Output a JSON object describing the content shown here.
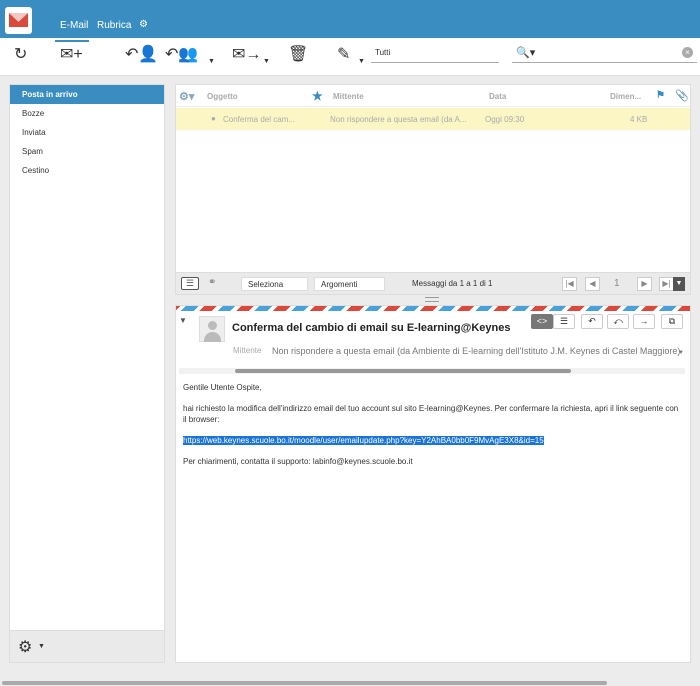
{
  "nav": {
    "mail": "E-Mail",
    "contacts": "Rubrica",
    "settings_icon": "⚙"
  },
  "toolbar": {
    "refresh_icon": "↻",
    "compose_icon": "✉+",
    "reply_icon": "↶👤",
    "replyall_icon": "↶👥",
    "forward_icon": "✉→",
    "delete_icon": "🗑",
    "mark_icon": "✎",
    "filter": "Tutti",
    "search_placeholder": ""
  },
  "folders": [
    "Posta in arrivo",
    "Bozze",
    "Inviata",
    "Spam",
    "Cestino"
  ],
  "list": {
    "headers": {
      "subject": "Oggetto",
      "from": "Mittente",
      "date": "Data",
      "size": "Dimen..."
    },
    "rows": [
      {
        "subject": "Conferma del cam...",
        "from": "Non rispondere a questa email (da A...",
        "date": "Oggi 09:30",
        "size": "4 KB"
      }
    ],
    "footer": {
      "select": "Seleziona",
      "threads": "Argomenti",
      "count": "Messaggi da 1 a 1 di 1",
      "page": "1"
    }
  },
  "preview": {
    "subject": "Conferma del cambio di email su E-learning@Keynes",
    "from_label": "Mittente",
    "from": "Non rispondere a questa email (da Ambiente di E-learning dell'Istituto J.M. Keynes di Castel Maggiore)",
    "body": {
      "greeting": "Gentile Utente Ospite,",
      "p1": "hai richiesto la modifica dell'indirizzo email del tuo account sul sito E-learning@Keynes. Per confermare la richiesta, apri il link seguente con il browser:",
      "link": "https://web.keynes.scuole.bo.it/moodle/user/emailupdate.php?key=Y2AhBA0bb0F9MvAgE3X8&id=15",
      "p2": "Per chiarimenti, contatta il supporto: labinfo@keynes.scuole.bo.it"
    }
  },
  "colors": {
    "accent": "#3a8dc1",
    "unread_row": "#fcf6c5",
    "airmail_red": "#d94a3d",
    "airmail_blue": "#4aa0d9"
  }
}
